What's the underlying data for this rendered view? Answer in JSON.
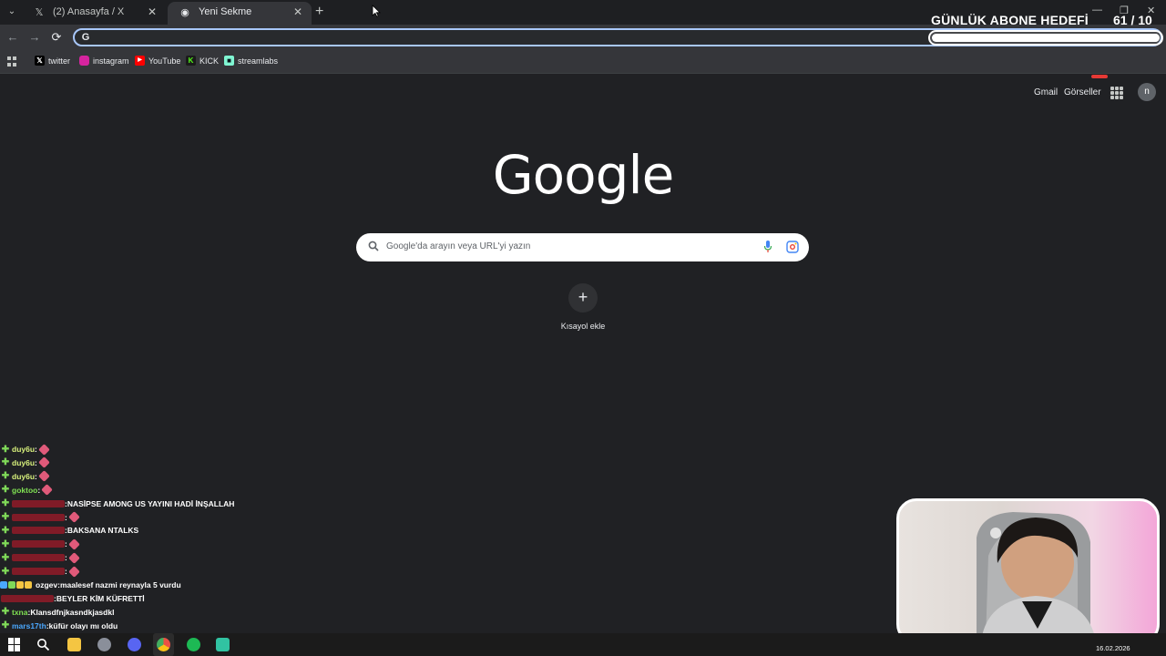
{
  "tabs": [
    {
      "label": "(2) Anasayfa / X",
      "icon": "x-logo-icon",
      "active": false
    },
    {
      "label": "Yeni Sekme",
      "icon": "chrome-icon",
      "active": true
    }
  ],
  "toolbar": {
    "back": "←",
    "forward": "→",
    "reload": "⟳",
    "omnibox_value": ""
  },
  "bookmarks": [
    {
      "label": "twitter",
      "icon": "x-logo-icon",
      "color": "#000000"
    },
    {
      "label": "instagram",
      "icon": "instagram-icon",
      "color": "#d6249f"
    },
    {
      "label": "YouTube",
      "icon": "youtube-icon",
      "color": "#ff0000"
    },
    {
      "label": "KICK",
      "icon": "kick-icon",
      "color": "#53fc18"
    },
    {
      "label": "streamlabs",
      "icon": "streamlabs-icon",
      "color": "#80f5d2"
    }
  ],
  "overlay": {
    "goal_title": "GÜNLÜK ABONE HEDEFİ",
    "goal_count": "61  / 10",
    "goal_progress": 1.0
  },
  "google": {
    "gmail": "Gmail",
    "images": "Görseller",
    "avatar_letter": "n",
    "logo": "Google",
    "search_placeholder": "Google'da arayın veya URL'yi yazın",
    "add_shortcut_symbol": "+",
    "add_shortcut_label": "Kısayol ekle"
  },
  "chat": [
    {
      "user": "duy6u",
      "user_color": "#d7f07c",
      "sep": " :",
      "msg": "",
      "emote": true
    },
    {
      "user": "duy6u",
      "user_color": "#d7f07c",
      "sep": " :",
      "msg": "",
      "emote": true
    },
    {
      "user": "duy6u",
      "user_color": "#d7f07c",
      "sep": " :",
      "msg": "",
      "emote": true
    },
    {
      "user": "goktoo",
      "user_color": "#7fe052",
      "sep": " :",
      "msg": "",
      "emote": true
    },
    {
      "user": "",
      "user_color": "#d0172a",
      "sep": " :",
      "msg": " NASİPSE AMONG US YAYINI HADİ İNŞALLAH",
      "emote": false
    },
    {
      "user": "",
      "user_color": "#d0172a",
      "sep": " :",
      "msg": "",
      "emote": true
    },
    {
      "user": "",
      "user_color": "#d0172a",
      "sep": " :",
      "msg": " BAKSANA NTALKS",
      "emote": false
    },
    {
      "user": "",
      "user_color": "#d0172a",
      "sep": " :",
      "msg": "",
      "emote": true
    },
    {
      "user": "",
      "user_color": "#d0172a",
      "sep": " :",
      "msg": "",
      "emote": true
    },
    {
      "user": "",
      "user_color": "#d0172a",
      "sep": " :",
      "msg": "",
      "emote": true
    },
    {
      "user": "ozgev",
      "user_color": "#ffffff",
      "sep": " :",
      "msg": " maalesef nazmi reynayla 5 vurdu",
      "emote": false,
      "badges": true
    },
    {
      "user": "",
      "user_color": "#d0172a",
      "sep": " :",
      "msg": " BEYLER KİM KÜFRETTİ",
      "emote": false,
      "no_plus": true
    },
    {
      "user": "txna",
      "user_color": "#7fe052",
      "sep": " :",
      "msg": " Klansdfnjkasndkjasdkl",
      "emote": false
    },
    {
      "user": "mars17th",
      "user_color": "#4aa8ff",
      "sep": " :",
      "msg": " küfür olayı mı oldu",
      "emote": false
    }
  ],
  "taskbar": {
    "date": "16.02.2026",
    "apps": [
      "windows-start-icon",
      "search-icon",
      "file-explorer-icon",
      "app-icon",
      "discord-icon",
      "chrome-icon",
      "spotify-icon",
      "streamlabs-icon"
    ]
  }
}
